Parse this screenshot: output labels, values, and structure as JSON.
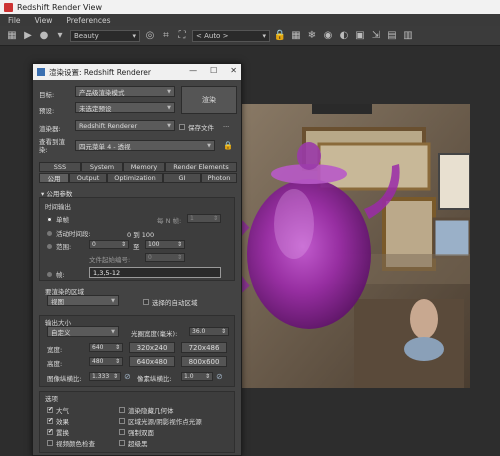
{
  "window": {
    "title": "Redshift Render View"
  },
  "menu": [
    "File",
    "View",
    "Preferences"
  ],
  "toolbar": {
    "channel": "Beauty",
    "zoom": "< Auto >"
  },
  "dialog": {
    "title": "渲染设置: Redshift Renderer",
    "target_label": "目标:",
    "target_value": "产品级渲染模式",
    "preset_label": "预设:",
    "preset_value": "未选定预设",
    "renderer_label": "渲染器:",
    "renderer_value": "Redshift Renderer",
    "save_file_label": "保存文件",
    "more_label": "...",
    "view_label": "查看到渲染:",
    "view_value": "四元菜单 4 - 透视",
    "render_button": "渲染",
    "tabs_row1": [
      "SSS",
      "System",
      "Memory",
      "Render Elements"
    ],
    "tabs_row2": [
      "公用",
      "Output",
      "Optimization",
      "GI",
      "Photon"
    ],
    "common_params_title": "公用参数",
    "time_output_title": "时间输出",
    "single_label": "单帧",
    "every_n_label": "每 N 帧:",
    "every_n_value": "1",
    "active_segment_label": "活动时间段:",
    "active_segment_value": "0 到 100",
    "range_label": "范围:",
    "range_from": "0",
    "range_to_label": "至",
    "range_to": "100",
    "file_start_label": "文件起始编号:",
    "file_start_value": "0",
    "frames_label": "帧:",
    "frames_value": "1,3,5-12",
    "render_area_title": "要渲染的区域",
    "render_area_value": "视图",
    "auto_region_label": "选择的自动区域",
    "output_size_title": "输出大小",
    "custom_value": "自定义",
    "aperture_label": "光圈宽度(毫米):",
    "aperture_value": "36.0",
    "width_label": "宽度:",
    "width_value": "640",
    "height_label": "高度:",
    "height_value": "480",
    "size_presets": [
      "320x240",
      "720x486",
      "640x480",
      "800x600"
    ],
    "image_aspect_label": "图像纵横比:",
    "image_aspect_value": "1.333",
    "pixel_aspect_label": "像素纵横比:",
    "pixel_aspect_value": "1.0",
    "options_title": "选项",
    "options": [
      {
        "label": "大气",
        "checked": true
      },
      {
        "label": "渲染隐藏几何体",
        "checked": false
      },
      {
        "label": "效果",
        "checked": true
      },
      {
        "label": "区域光源/阴影视作点光源",
        "checked": false
      },
      {
        "label": "置换",
        "checked": true
      },
      {
        "label": "强制双面",
        "checked": false
      },
      {
        "label": "视频颜色检查",
        "checked": false
      },
      {
        "label": "超级黑",
        "checked": false
      }
    ]
  }
}
